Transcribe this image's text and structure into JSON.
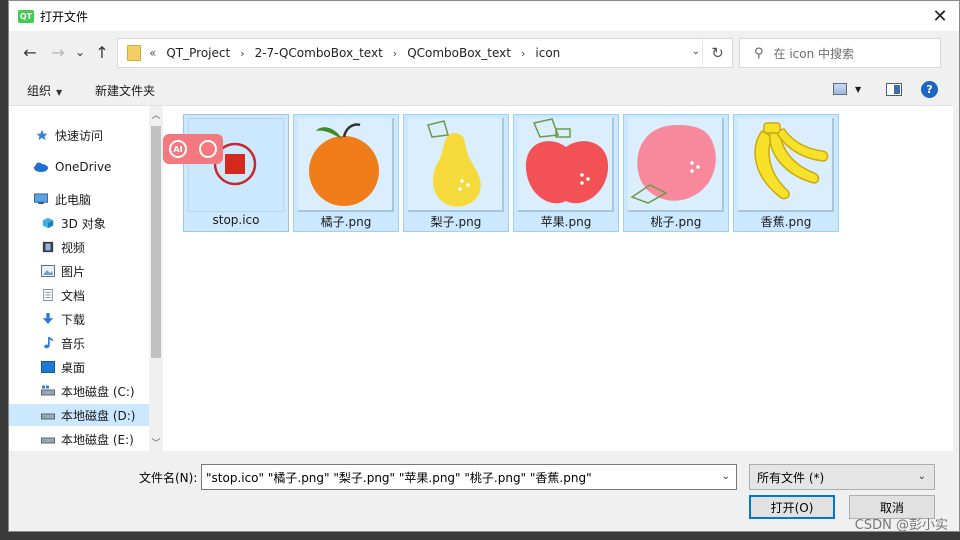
{
  "window": {
    "title": "打开文件",
    "app_icon": "QT",
    "close": "✕"
  },
  "nav": {
    "back": "←",
    "forward": "→",
    "recent": "⌄",
    "up": "↑",
    "breadcrumb_prefix": "«",
    "breadcrumbs": [
      "QT_Project",
      "2-7-QComboBox_text",
      "QComboBox_text",
      "icon"
    ],
    "refresh": "↻",
    "search_placeholder": "在 icon 中搜索"
  },
  "toolbar": {
    "organize": "组织",
    "new_folder": "新建文件夹",
    "help": "?"
  },
  "sidebar": {
    "items": [
      {
        "label": "快速访问",
        "icon": "star-icon"
      },
      {
        "label": "OneDrive",
        "icon": "cloud-icon"
      },
      {
        "label": "此电脑",
        "icon": "computer-icon"
      },
      {
        "label": "3D 对象",
        "icon": "cube-icon"
      },
      {
        "label": "视频",
        "icon": "video-icon"
      },
      {
        "label": "图片",
        "icon": "picture-icon"
      },
      {
        "label": "文档",
        "icon": "document-icon"
      },
      {
        "label": "下载",
        "icon": "download-icon"
      },
      {
        "label": "音乐",
        "icon": "music-icon"
      },
      {
        "label": "桌面",
        "icon": "desktop-icon"
      },
      {
        "label": "本地磁盘 (C:)",
        "icon": "drive-icon"
      },
      {
        "label": "本地磁盘 (D:)",
        "icon": "drive-icon",
        "selected": true
      },
      {
        "label": "本地磁盘 (E:)",
        "icon": "drive-icon"
      }
    ]
  },
  "files": [
    {
      "name": "stop.ico",
      "icon": "stop-icon"
    },
    {
      "name": "橘子.png",
      "icon": "orange-icon"
    },
    {
      "name": "梨子.png",
      "icon": "pear-icon"
    },
    {
      "name": "苹果.png",
      "icon": "apple-icon"
    },
    {
      "name": "桃子.png",
      "icon": "peach-icon"
    },
    {
      "name": "香蕉.png",
      "icon": "banana-icon"
    }
  ],
  "overlay": {
    "ai": "AI"
  },
  "footer": {
    "filename_label": "文件名(N):",
    "filename_value": "\"stop.ico\" \"橘子.png\" \"梨子.png\" \"苹果.png\" \"桃子.png\" \"香蕉.png\"",
    "filter_value": "所有文件 (*)",
    "open_button": "打开(O)",
    "cancel_button": "取消"
  },
  "watermark": "CSDN @彭小实",
  "colors": {
    "selection": "#cce8ff",
    "accent": "#0078d7"
  }
}
